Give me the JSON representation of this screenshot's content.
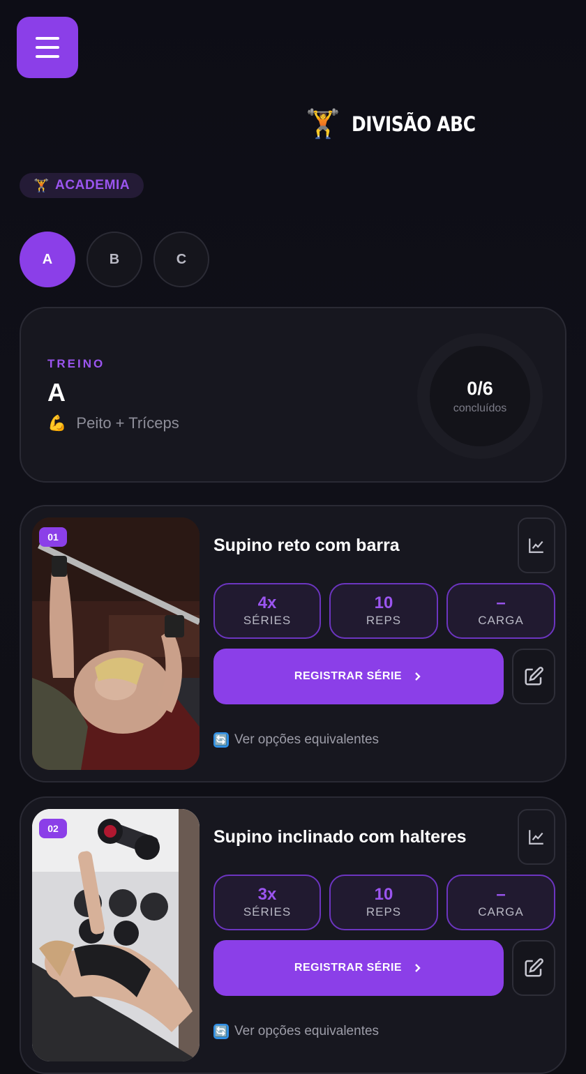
{
  "header": {
    "title": "DIVISÃO ABC",
    "title_icon": "🏋️"
  },
  "badge": {
    "label": "ACADEMIA",
    "icon": "🏋️"
  },
  "tabs": [
    {
      "label": "A",
      "active": true
    },
    {
      "label": "B",
      "active": false
    },
    {
      "label": "C",
      "active": false
    }
  ],
  "summary": {
    "label": "TREINO",
    "letter": "A",
    "icon": "💪",
    "subtitle": "Peito + Tríceps",
    "completed": "0/6",
    "completed_label": "concluídos",
    "progress": 0
  },
  "exercises": [
    {
      "number": "01",
      "name": "Supino reto com barra",
      "stats": [
        {
          "value": "4x",
          "label": "SÉRIES"
        },
        {
          "value": "10",
          "label": "REPS"
        },
        {
          "value": "–",
          "label": "CARGA"
        }
      ],
      "register_label": "REGISTRAR SÉRIE",
      "alt_label": "Ver opções equivalentes",
      "alt_icon": "🔄"
    },
    {
      "number": "02",
      "name": "Supino inclinado com halteres",
      "stats": [
        {
          "value": "3x",
          "label": "SÉRIES"
        },
        {
          "value": "10",
          "label": "REPS"
        },
        {
          "value": "–",
          "label": "CARGA"
        }
      ],
      "register_label": "REGISTRAR SÉRIE",
      "alt_label": "Ver opções equivalentes",
      "alt_icon": "🔄"
    }
  ],
  "icons": {
    "menu": "hamburger-menu-icon",
    "chart": "line-chart-icon",
    "edit": "edit-icon",
    "chevron": "chevron-right-icon"
  },
  "colors": {
    "accent": "#8b3fe8",
    "background": "#0f0f17",
    "card": "#17171f"
  }
}
